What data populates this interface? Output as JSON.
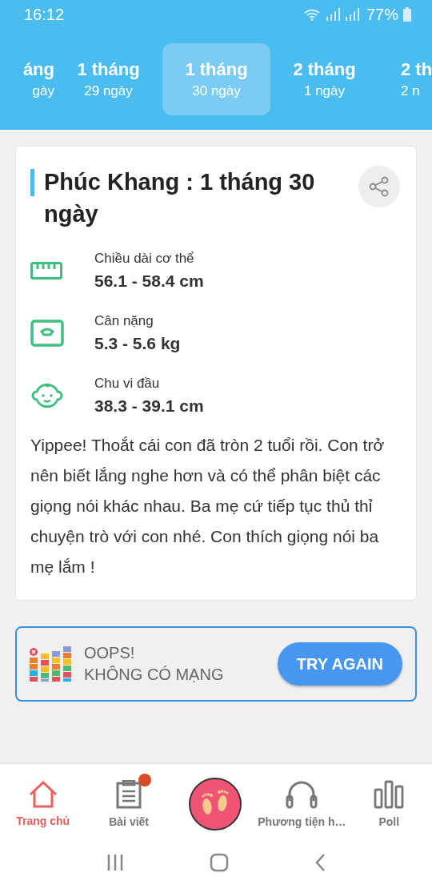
{
  "status_bar": {
    "time": "16:12",
    "battery": "77%"
  },
  "age_tabs": [
    {
      "month": "áng",
      "day": "gày",
      "selected": false
    },
    {
      "month": "1 tháng",
      "day": "29 ngày",
      "selected": false
    },
    {
      "month": "1 tháng",
      "day": "30 ngày",
      "selected": true
    },
    {
      "month": "2 tháng",
      "day": "1 ngày",
      "selected": false
    },
    {
      "month": "2 th",
      "day": "2 n",
      "selected": false
    }
  ],
  "card": {
    "title": "Phúc Khang : 1 tháng 30 ngày",
    "measurements": [
      {
        "kind": "ruler",
        "label": "Chiều dài cơ thể",
        "value": "56.1 - 58.4 cm"
      },
      {
        "kind": "scale",
        "label": "Cân nặng",
        "value": "5.3 - 5.6 kg"
      },
      {
        "kind": "baby",
        "label": "Chu vi đầu",
        "value": "38.3 - 39.1 cm"
      }
    ],
    "description": "Yippee! Thoắt cái con đã tròn 2 tuổi rồi. Con trở nên biết lắng nghe hơn và có thể phân biệt các giọng nói khác nhau. Ba mẹ cứ tiếp tục thủ thỉ chuyện trò với con nhé. Con thích giọng nói ba mẹ lắm !"
  },
  "offline_banner": {
    "title": "OOPS!",
    "message": "KHÔNG CÓ MẠNG",
    "button": "TRY AGAIN"
  },
  "bottom_nav": [
    {
      "kind": "home",
      "label": "Trang chủ",
      "selected": true,
      "badge": false
    },
    {
      "kind": "articles",
      "label": "Bài viết",
      "selected": false,
      "badge": true
    },
    {
      "kind": "feet",
      "selected": false,
      "badge": false
    },
    {
      "kind": "media",
      "label": "Phương tiện h…",
      "selected": false,
      "badge": false
    },
    {
      "kind": "poll",
      "label": "Poll",
      "selected": false,
      "badge": false
    }
  ]
}
